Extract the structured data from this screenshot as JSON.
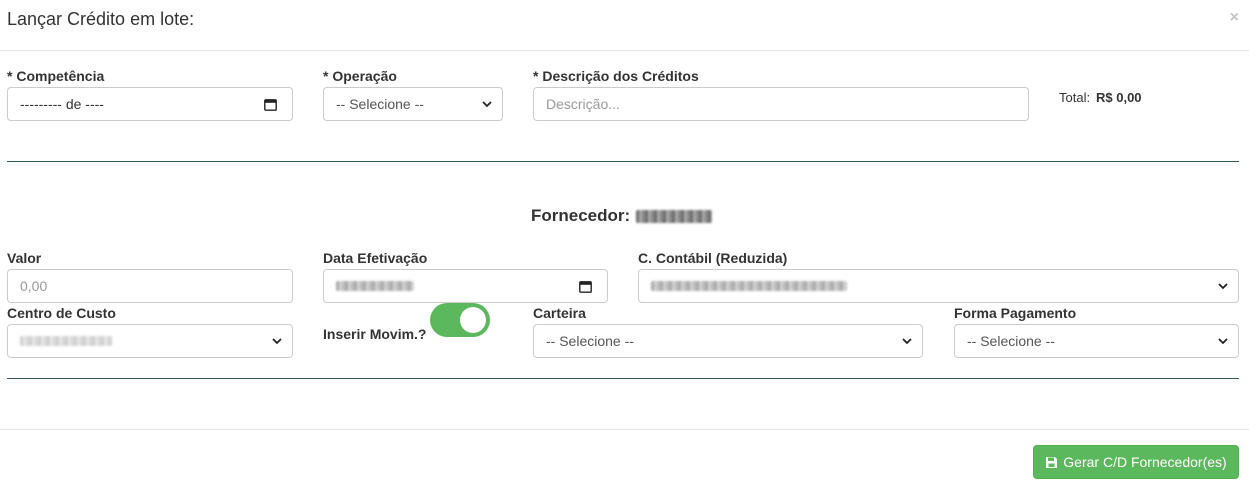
{
  "modal": {
    "title": "Lançar Crédito em lote:",
    "close_glyph": "×"
  },
  "header_row": {
    "competencia": {
      "label": "* Competência",
      "value": "--------- de ----",
      "icon": "calendar-icon"
    },
    "operacao": {
      "label": "* Operação",
      "selected": "-- Selecione --",
      "icon": "chevron-down-icon"
    },
    "descricao": {
      "label": "* Descrição dos Créditos",
      "placeholder": "Descrição..."
    },
    "total": {
      "label": "Total:",
      "value": "R$ 0,00"
    }
  },
  "fornecedor": {
    "label": "Fornecedor:"
  },
  "form": {
    "valor": {
      "label": "Valor",
      "placeholder": "0,00"
    },
    "data_efetivacao": {
      "label": "Data Efetivação",
      "icon": "calendar-icon"
    },
    "conta_contabil": {
      "label": "C. Contábil (Reduzida)",
      "icon": "chevron-down-icon"
    },
    "centro_custo": {
      "label": "Centro de Custo",
      "icon": "chevron-down-icon"
    },
    "inserir_movim": {
      "label": "Inserir Movim.?",
      "checked": true
    },
    "carteira": {
      "label": "Carteira",
      "selected": "-- Selecione --",
      "icon": "chevron-down-icon"
    },
    "forma_pagamento": {
      "label": "Forma Pagamento",
      "selected": "-- Selecione --",
      "icon": "chevron-down-icon"
    }
  },
  "footer": {
    "button_label": "Gerar C/D Fornecedor(es)",
    "button_icon": "floppy-disk-icon"
  },
  "colors": {
    "success": "#5cb85c",
    "divider": "#2f5753",
    "border": "#cccccc",
    "text": "#333333"
  }
}
